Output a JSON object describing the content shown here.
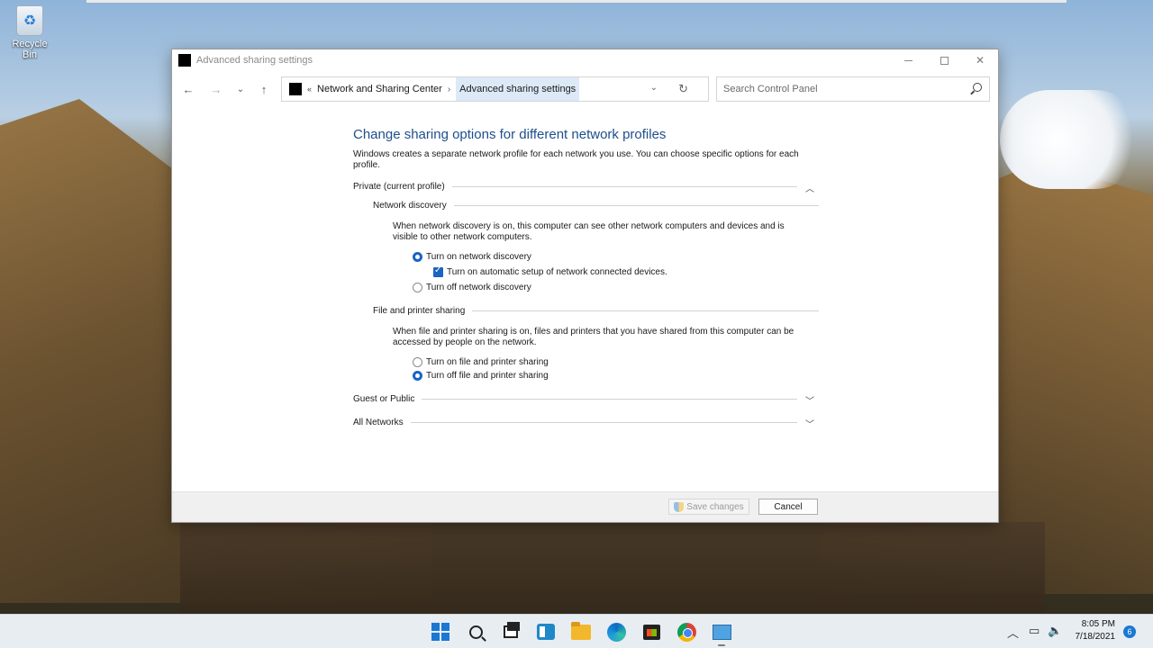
{
  "desktop": {
    "recycle_bin_label": "Recycle Bin"
  },
  "window": {
    "title": "Advanced sharing settings",
    "minimize_icon": "minimize-icon",
    "maximize_icon": "maximize-icon",
    "close_glyph": "✕"
  },
  "nav": {
    "back_glyph": "←",
    "forward_glyph": "→",
    "recent_glyph": "⌄",
    "up_glyph": "↑",
    "address_chevron": "«",
    "breadcrumb_parent": "Network and Sharing Center",
    "breadcrumb_sep": "›",
    "breadcrumb_current": "Advanced sharing settings",
    "dropdown_glyph": "⌄",
    "refresh_glyph": "↻",
    "search_placeholder": "Search Control Panel"
  },
  "content": {
    "heading": "Change sharing options for different network profiles",
    "intro": "Windows creates a separate network profile for each network you use. You can choose specific options for each profile.",
    "private_section": {
      "label": "Private (current profile)",
      "chevron": "︿",
      "network_discovery": {
        "label": "Network discovery",
        "description": "When network discovery is on, this computer can see other network computers and devices and is visible to other network computers.",
        "option_on": "Turn on network discovery",
        "option_auto_setup": "Turn on automatic setup of network connected devices.",
        "option_off": "Turn off network discovery",
        "selected": "on",
        "auto_setup_checked": true
      },
      "file_printer_sharing": {
        "label": "File and printer sharing",
        "description": "When file and printer sharing is on, files and printers that you have shared from this computer can be accessed by people on the network.",
        "option_on": "Turn on file and printer sharing",
        "option_off": "Turn off file and printer sharing",
        "selected": "off"
      }
    },
    "guest_section": {
      "label": "Guest or Public",
      "chevron": "﹀"
    },
    "all_networks_section": {
      "label": "All Networks",
      "chevron": "﹀"
    }
  },
  "footer": {
    "save_label": "Save changes",
    "cancel_label": "Cancel"
  },
  "taskbar": {
    "apps": [
      "start-icon",
      "search-icon",
      "task-view-icon",
      "widgets-icon",
      "file-explorer-icon",
      "edge-icon",
      "store-icon",
      "chrome-icon",
      "control-panel-icon"
    ],
    "tray_chevron": "︿",
    "time": "8:05 PM",
    "date": "7/18/2021",
    "notification_count": "6",
    "accent_color": "#1a78d4"
  }
}
